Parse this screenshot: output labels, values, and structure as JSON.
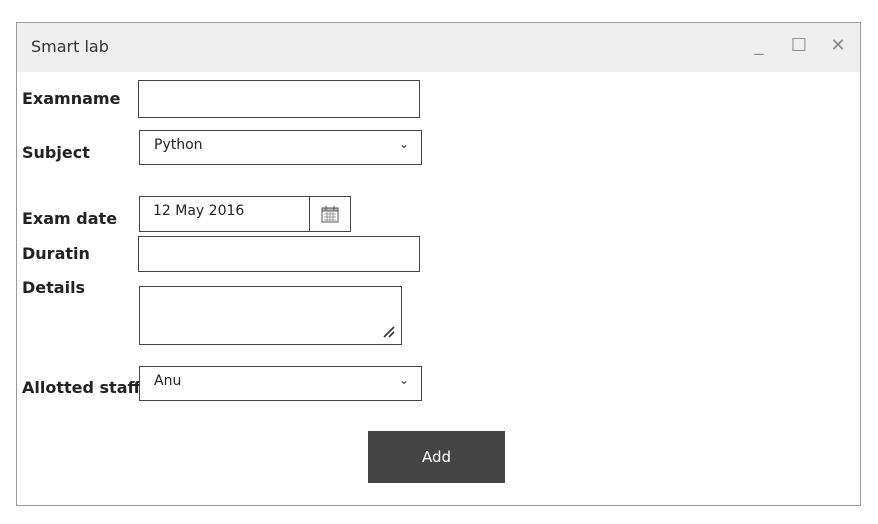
{
  "window": {
    "title": "Smart lab",
    "minimize_glyph": "_",
    "maximize_glyph": "☐",
    "close_glyph": "✕"
  },
  "form": {
    "examname": {
      "label": "Examname",
      "value": ""
    },
    "subject": {
      "label": "Subject",
      "value": "Python"
    },
    "exam_date": {
      "label": "Exam date",
      "value": "12 May 2016",
      "icon": "calendar-icon"
    },
    "duration": {
      "label": "Duratin",
      "value": ""
    },
    "details": {
      "label": "Details",
      "value": ""
    },
    "allotted_staff": {
      "label": "Allotted staff",
      "value": "Anu"
    },
    "add_button": "Add"
  },
  "colors": {
    "titlebar_bg": "#efefef",
    "button_bg": "#444444",
    "button_text": "#ffffff",
    "border": "#444444"
  }
}
